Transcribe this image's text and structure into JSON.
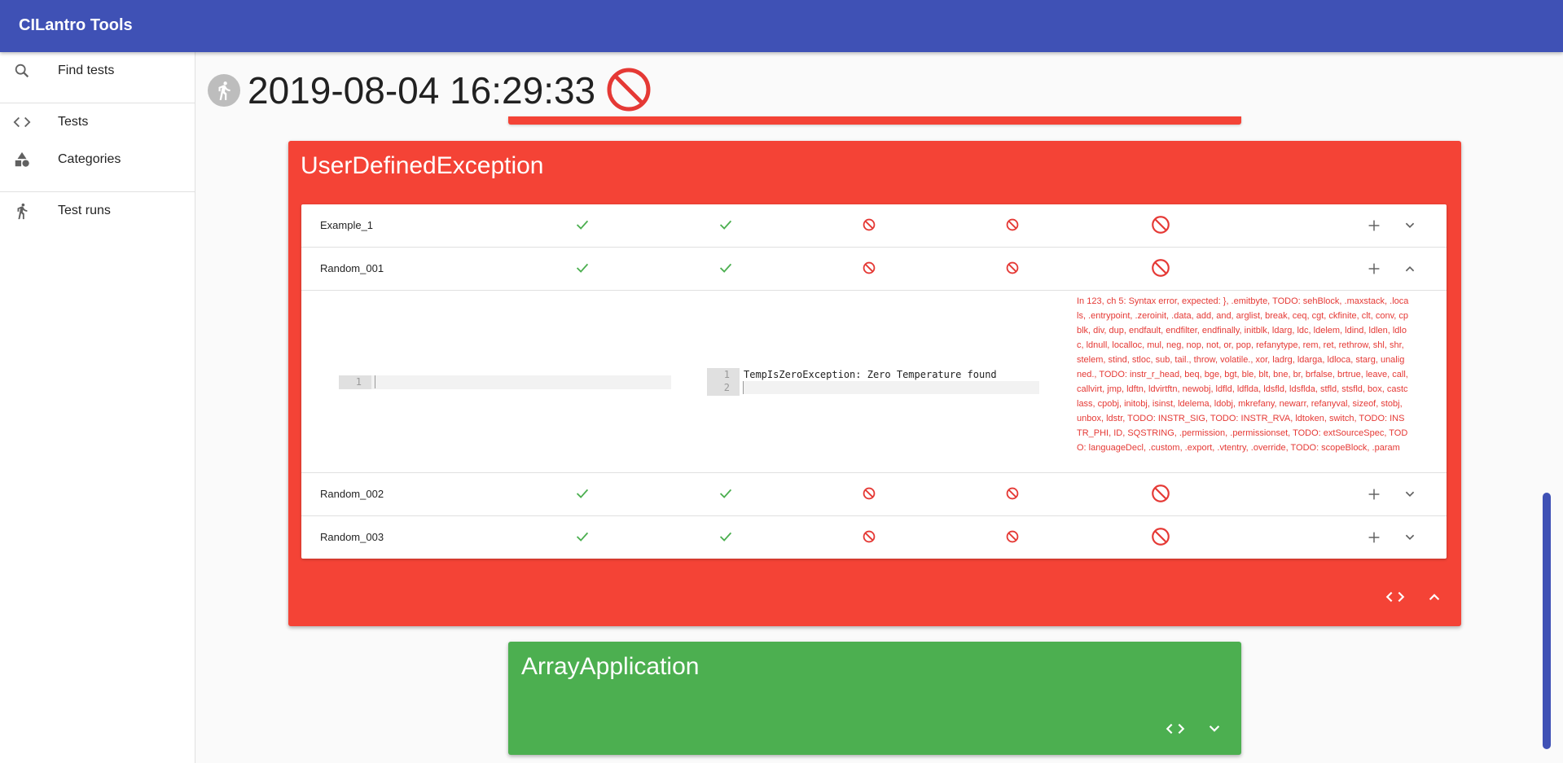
{
  "appbar": {
    "title": "CILantro Tools"
  },
  "nav": {
    "items": [
      {
        "label": "Find tests",
        "icon": "search-icon"
      },
      {
        "label": "Tests",
        "icon": "code-icon"
      },
      {
        "label": "Categories",
        "icon": "category-shapes-icon"
      },
      {
        "label": "Test runs",
        "icon": "run-icon"
      }
    ]
  },
  "run": {
    "timestamp": "2019-08-04 16:29:33",
    "status_icon": "blocked-icon"
  },
  "categories": [
    {
      "title": "UserDefinedException",
      "color": "#f44336",
      "rows": [
        {
          "name": "Example_1",
          "results": [
            "check",
            "check",
            "blocked",
            "blocked",
            "blocked"
          ],
          "expanded": false
        },
        {
          "name": "Random_001",
          "results": [
            "check",
            "check",
            "blocked",
            "blocked",
            "blocked"
          ],
          "expanded": true
        },
        {
          "name": "Random_002",
          "results": [
            "check",
            "check",
            "blocked",
            "blocked",
            "blocked"
          ],
          "expanded": false
        },
        {
          "name": "Random_003",
          "results": [
            "check",
            "check",
            "blocked",
            "blocked",
            "blocked"
          ],
          "expanded": false
        }
      ],
      "detail": {
        "input_line_numbers": [
          "1"
        ],
        "input_lines": [
          ""
        ],
        "output_line_numbers": [
          "1",
          "2"
        ],
        "output_lines": [
          "TempIsZeroException: Zero Temperature found",
          ""
        ],
        "error": "In 123, ch 5: Syntax error, expected: }, .emitbyte, TODO: sehBlock, .maxstack, .locals, .entrypoint, .zeroinit, .data, add, and, arglist, break, ceq, cgt, ckfinite, clt, conv, cpblk, div, dup, endfault, endfilter, endfinally, initblk, ldarg, ldc, ldelem, ldind, ldlen, ldloc, ldnull, localloc, mul, neg, nop, not, or, pop, refanytype, rem, ret, rethrow, shl, shr, stelem, stind, stloc, sub, tail., throw, volatile., xor, ladrg, ldarga, ldloca, starg, unaligned., TODO: instr_r_head, beq, bge, bgt, ble, blt, bne, br, brfalse, brtrue, leave, call, callvirt, jmp, ldftn, ldvirtftn, newobj, ldfld, ldflda, ldsfld, ldsflda, stfld, stsfld, box, castclass, cpobj, initobj, isinst, ldelema, ldobj, mkrefany, newarr, refanyval, sizeof, stobj, unbox, ldstr, TODO: INSTR_SIG, TODO: INSTR_RVA, ldtoken, switch, TODO: INSTR_PHI, ID, SQSTRING, .permission, .permissionset, TODO: extSourceSpec, TODO: languageDecl, .custom, .export, .vtentry, .override, TODO: scopeBlock, .param"
      }
    },
    {
      "title": "ArrayApplication",
      "color": "#4caf50"
    }
  ]
}
